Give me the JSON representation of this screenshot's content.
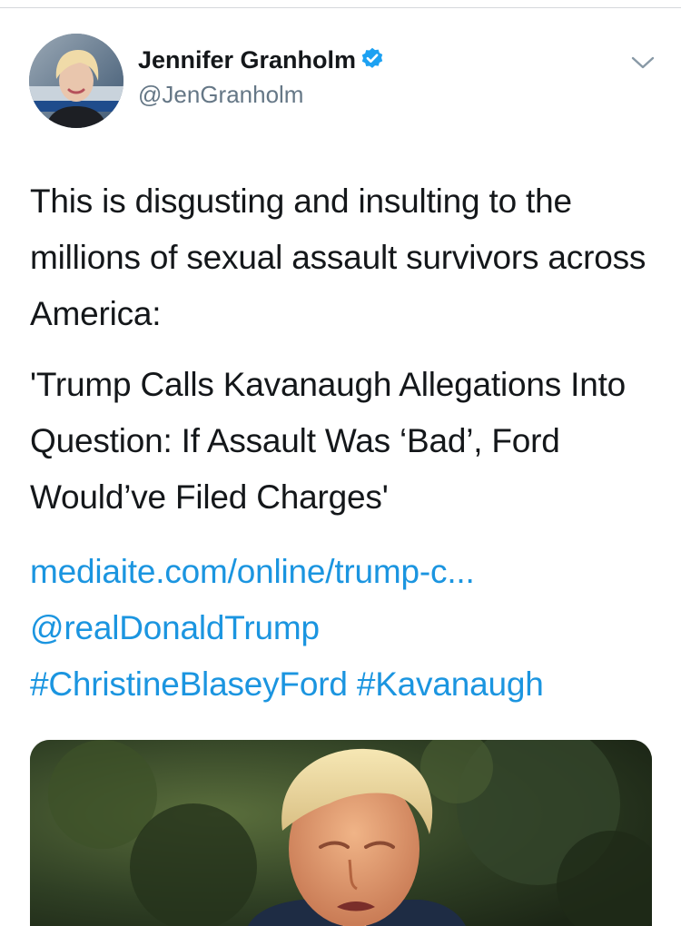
{
  "author": {
    "name": "Jennifer Granholm",
    "handle": "@JenGranholm"
  },
  "icons": {
    "verified": "verified-badge-icon",
    "menu": "chevron-down-icon"
  },
  "colors": {
    "link": "#1b95e0",
    "verified": "#1da1f2",
    "secondary_text": "#657786"
  },
  "tweet": {
    "paragraph_1": "This is disgusting and insulting to the millions of sexual assault survivors across America:",
    "paragraph_2": "'Trump Calls Kavanaugh Allegations Into Question: If Assault Was ‘Bad’, Ford Would’ve Filed Charges'",
    "link_url": "mediaite.com/online/trump-c...",
    "mention": "@realDonaldTrump",
    "hashtag_1": "#ChristineBlaseyFord",
    "hashtag_2": "#Kavanaugh"
  }
}
